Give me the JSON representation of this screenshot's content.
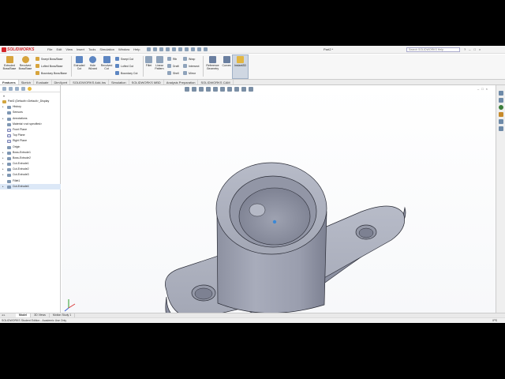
{
  "app": {
    "logo_text": "SOLIDWORKS",
    "menu": [
      "File",
      "Edit",
      "View",
      "Insert",
      "Tools",
      "Simulation",
      "Window",
      "Help"
    ],
    "document_title": "Part2 *",
    "search_placeholder": "Search SOLIDWORKS Help",
    "window_buttons": [
      "?",
      "–",
      "□",
      "×"
    ]
  },
  "ribbon": {
    "extruded_boss": "Extruded Boss/Base",
    "revolved_boss": "Revolved Boss/Base",
    "swept_boss": "Swept Boss/Base",
    "lofted_boss": "Lofted Boss/Base",
    "boundary_boss": "Boundary Boss/Base",
    "extruded_cut": "Extruded Cut",
    "hole_wizard": "Hole Wizard",
    "revolved_cut": "Revolved Cut",
    "swept_cut": "Swept Cut",
    "lofted_cut": "Lofted Cut",
    "boundary_cut": "Boundary Cut",
    "fillet": "Fillet",
    "linear_pattern": "Linear Pattern",
    "rib": "Rib",
    "draft": "Draft",
    "shell": "Shell",
    "wrap": "Wrap",
    "intersect": "Intersect",
    "mirror": "Mirror",
    "reference_geometry": "Reference Geometry",
    "curves": "Curves",
    "instant3d": "Instant3D"
  },
  "command_tabs": [
    "Features",
    "Sketch",
    "Evaluate",
    "DimXpert",
    "SOLIDWORKS Add-Ins",
    "Simulation",
    "SOLIDWORKS MBD",
    "Analysis Preparation",
    "SOLIDWORKS CAM"
  ],
  "feature_tree": [
    {
      "label": "Part2  (Default<<Default>_Display",
      "kind": "root",
      "caret": ""
    },
    {
      "label": "History",
      "kind": "folder",
      "caret": "▸"
    },
    {
      "label": "Sensors",
      "kind": "folder",
      "caret": ""
    },
    {
      "label": "Annotations",
      "kind": "folder",
      "caret": "▸"
    },
    {
      "label": "Material <not specified>",
      "kind": "folder",
      "caret": ""
    },
    {
      "label": "Front Plane",
      "kind": "plane",
      "caret": ""
    },
    {
      "label": "Top Plane",
      "kind": "plane",
      "caret": ""
    },
    {
      "label": "Right Plane",
      "kind": "plane",
      "caret": ""
    },
    {
      "label": "Origin",
      "kind": "origin",
      "caret": ""
    },
    {
      "label": "Boss-Extrude1",
      "kind": "feature",
      "caret": "▸"
    },
    {
      "label": "Boss-Extrude2",
      "kind": "feature",
      "caret": "▸"
    },
    {
      "label": "Cut-Extrude1",
      "kind": "feature",
      "caret": "▸"
    },
    {
      "label": "Cut-Extrude2",
      "kind": "feature",
      "caret": "▸"
    },
    {
      "label": "Cut-Extrude3",
      "kind": "feature",
      "caret": "▸"
    },
    {
      "label": "Fillet1",
      "kind": "feature",
      "caret": ""
    },
    {
      "label": "Cut-Extrude4",
      "kind": "feature",
      "caret": "▸"
    }
  ],
  "bottom_tabs": [
    "Model",
    "3D Views",
    "Motion Study 1"
  ],
  "status": {
    "left": "SOLIDWORKS Student Edition - Academic Use Only",
    "right": "IPS"
  },
  "colors": {
    "part_face": "#a4a8b7",
    "part_edge": "#2a2c36",
    "selection": "#dce8f7",
    "brand": "#d4252a"
  }
}
